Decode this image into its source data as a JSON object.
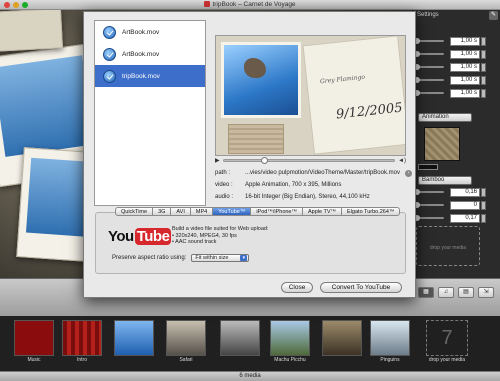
{
  "window": {
    "title": "tripBook – Carnet de Voyage"
  },
  "inspector": {
    "header": "Settings",
    "rows": [
      "1,00 s",
      "1,00 s",
      "1,00 s",
      "1,00 s",
      "1,00 s"
    ],
    "animation_select": "Animation",
    "style_select": "Bamboo",
    "rows2": [
      "0,16",
      "0",
      "0,17"
    ],
    "drop_hint": "drop your media"
  },
  "files": [
    {
      "name": "ArtBook.mov",
      "selected": false
    },
    {
      "name": "ArtBook.mov",
      "selected": false
    },
    {
      "name": "tripBook.mov",
      "selected": true
    }
  ],
  "preview": {
    "script_small": "Grey Flamingo",
    "script_date": "9/12/2005"
  },
  "meta": {
    "path_key": "path :",
    "path_val": "...vies/video pulpmotion/VideoTheme/Master/tripBook.mov",
    "video_key": "video :",
    "video_val": "Apple Animation, 700 x 395, Millions",
    "audio_key": "audio :",
    "audio_val": "16-bit Integer (Big Endian), Stereo, 44,100 kHz"
  },
  "tabs": [
    "QuickTime",
    "3G",
    "AVI",
    "MP4",
    "YouTube™",
    "iPod™/iPhone™",
    "Apple TV™",
    "Elgato Turbo.264™"
  ],
  "selected_tab": "YouTube™",
  "youtube": {
    "logo_you": "You",
    "logo_tube": "Tube",
    "desc_line1": "Build a video file suited for Web upload:",
    "desc_line2": "• 320x240, MPEG4, 30 fps",
    "desc_line3": "• AAC sound track",
    "aspect_label": "Preserve aspect ratio using:",
    "aspect_value": "Fit within size"
  },
  "buttons": {
    "close": "Close",
    "convert": "Convert To YouTube"
  },
  "filmstrip": {
    "clips": [
      "Music",
      "Intro",
      "",
      "Safari",
      "",
      "Machu Picchu",
      "",
      "Pinguins",
      "drop your media"
    ],
    "drop_number": "7"
  },
  "status": "6 media",
  "colors": {
    "accent": "#3d6ec9",
    "youtube_red": "#d6272c"
  }
}
